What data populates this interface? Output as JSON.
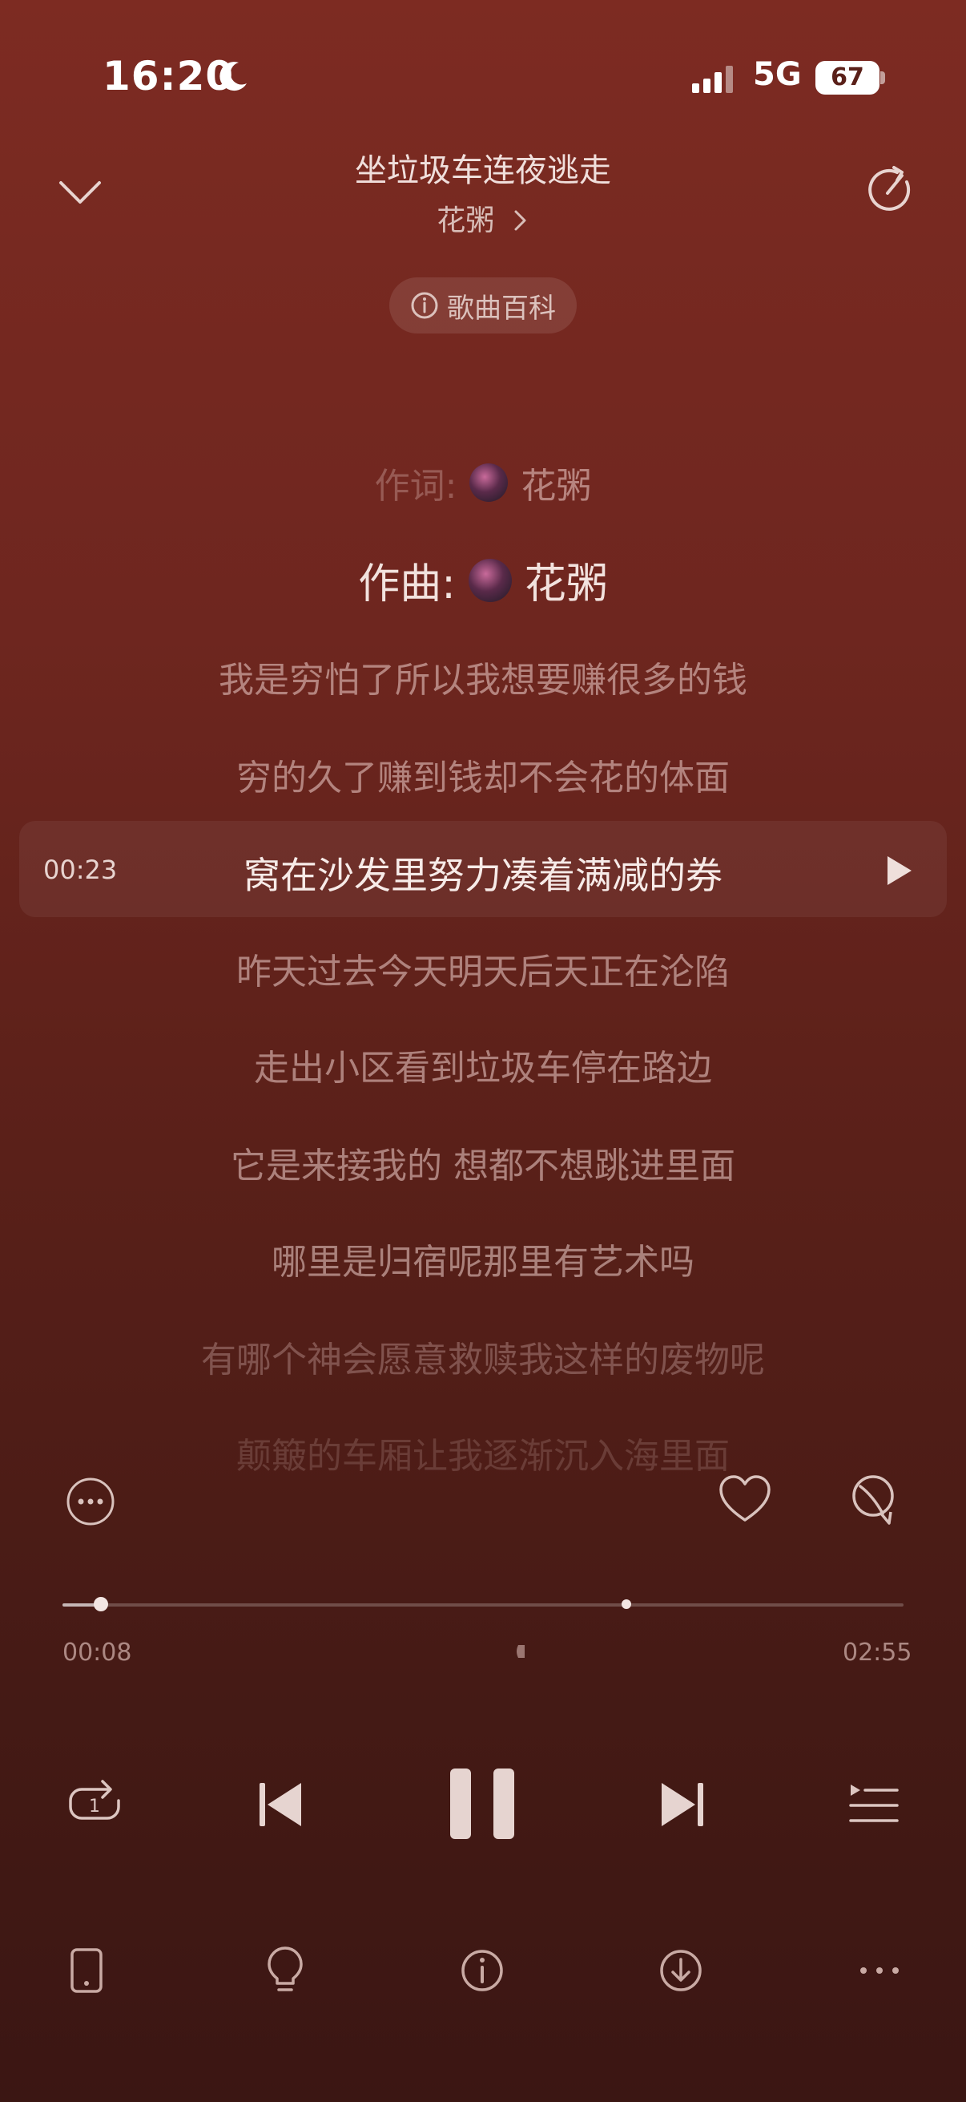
{
  "status_bar": {
    "time": "16:20",
    "network": "5G",
    "battery": "67",
    "battery_level": 0.67
  },
  "header": {
    "song_title": "坐垃圾车连夜逃走",
    "artist": "花粥",
    "wiki_label": "歌曲百科"
  },
  "lyrics": {
    "lyricist_label": "作词:",
    "lyricist_name": "花粥",
    "composer_label": "作曲:",
    "composer_name": "花粥",
    "lines": [
      "我是穷怕了所以我想要赚很多的钱",
      "穷的久了赚到钱却不会花的体面",
      "窝在沙发里努力凑着满减的券",
      "昨天过去今天明天后天正在沦陷",
      "走出小区看到垃圾车停在路边",
      "它是来接我的 想都不想跳进里面",
      "哪里是归宿呢那里有艺术吗",
      "有哪个神会愿意救赎我这样的废物呢",
      "颠簸的车厢让我逐渐沉入海里面"
    ],
    "current_index": 2,
    "current_time": "00:23"
  },
  "progress": {
    "elapsed": "00:08",
    "total": "02:55",
    "played_fraction": 0.046,
    "marker_fraction": 0.67
  },
  "icons": {
    "collapse": "chevron-down-icon",
    "share": "share-icon",
    "info": "info-icon",
    "more": "more-circle-icon",
    "like": "heart-icon",
    "comment": "comment-icon",
    "loop": "repeat-one-icon",
    "prev": "skip-previous-icon",
    "pause": "pause-icon",
    "next": "skip-next-icon",
    "queue": "playlist-icon",
    "device": "phone-device-icon",
    "tips": "lightbulb-icon",
    "about": "info-circle-icon",
    "download": "download-icon",
    "overflow": "more-horizontal-icon"
  },
  "colors": {
    "background_top": "#7d2b22",
    "background_bottom": "#3b1613",
    "text_primary": "#f3e6e3"
  }
}
